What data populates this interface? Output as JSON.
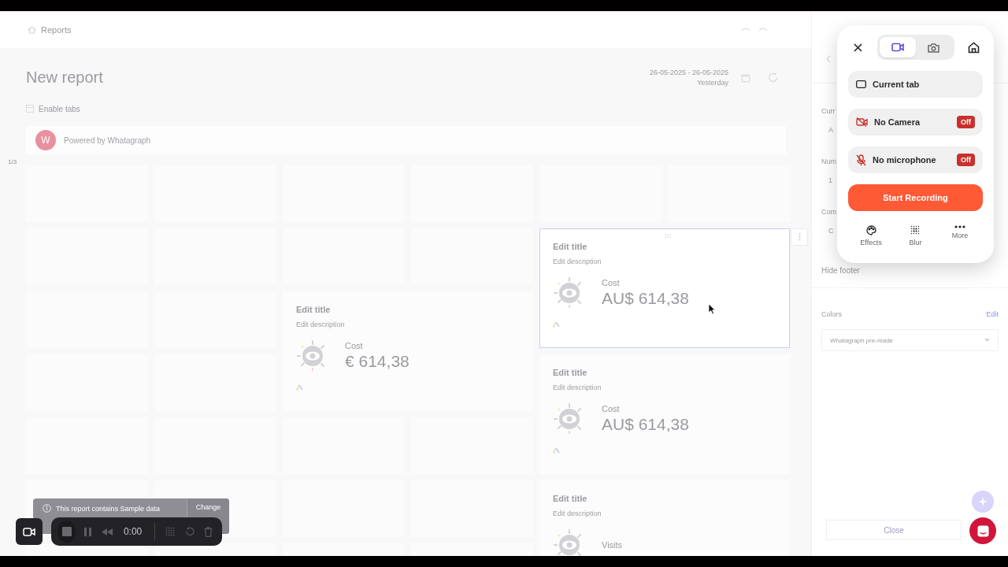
{
  "breadcrumb": {
    "label": "Reports"
  },
  "report": {
    "title": "New report",
    "date_range": "26-05-2025 - 26-05-2025",
    "date_preset": "Yesterday",
    "enable_tabs": "Enable tabs",
    "page_marker": "1/3",
    "branding": {
      "logo": "W",
      "text": "Powered by Whatagraph"
    }
  },
  "widgets": [
    {
      "title": "Edit title",
      "description": "Edit description",
      "metric": "Cost",
      "value": "€ 614,38",
      "selected": false
    },
    {
      "title": "Edit title",
      "description": "Edit description",
      "metric": "Cost",
      "value": "AU$ 614,38",
      "selected": true
    },
    {
      "title": "Edit title",
      "description": "Edit description",
      "metric": "Cost",
      "value": "AU$ 614,38",
      "selected": false
    },
    {
      "title": "Edit title",
      "description": "Edit description",
      "metric": "Visits",
      "selected": false
    }
  ],
  "sample_banner": {
    "text": "This report contains Sample data",
    "action": "Change"
  },
  "side_panel": {
    "fields": [
      {
        "label": "Curr",
        "value": "A"
      },
      {
        "label": "Num",
        "value": "1"
      },
      {
        "label": "Com",
        "value": "C"
      }
    ],
    "hide_footer": "Hide footer",
    "colors": {
      "label": "Colors",
      "action": "Edit",
      "value": "Whatagraph pre-made"
    },
    "close": "Close"
  },
  "recorder_popup": {
    "modes": [
      {
        "kind": "video",
        "selected": true
      },
      {
        "kind": "photo",
        "selected": false
      }
    ],
    "source": "Current tab",
    "devices": [
      {
        "kind": "camera",
        "label": "No Camera",
        "status": "Off"
      },
      {
        "kind": "microphone",
        "label": "No microphone",
        "status": "Off"
      }
    ],
    "start": "Start Recording",
    "tools": [
      {
        "kind": "effects",
        "label": "Effects"
      },
      {
        "kind": "blur",
        "label": "Blur"
      },
      {
        "kind": "more",
        "label": "More"
      }
    ]
  },
  "recorder_bar": {
    "time": "0:00"
  }
}
